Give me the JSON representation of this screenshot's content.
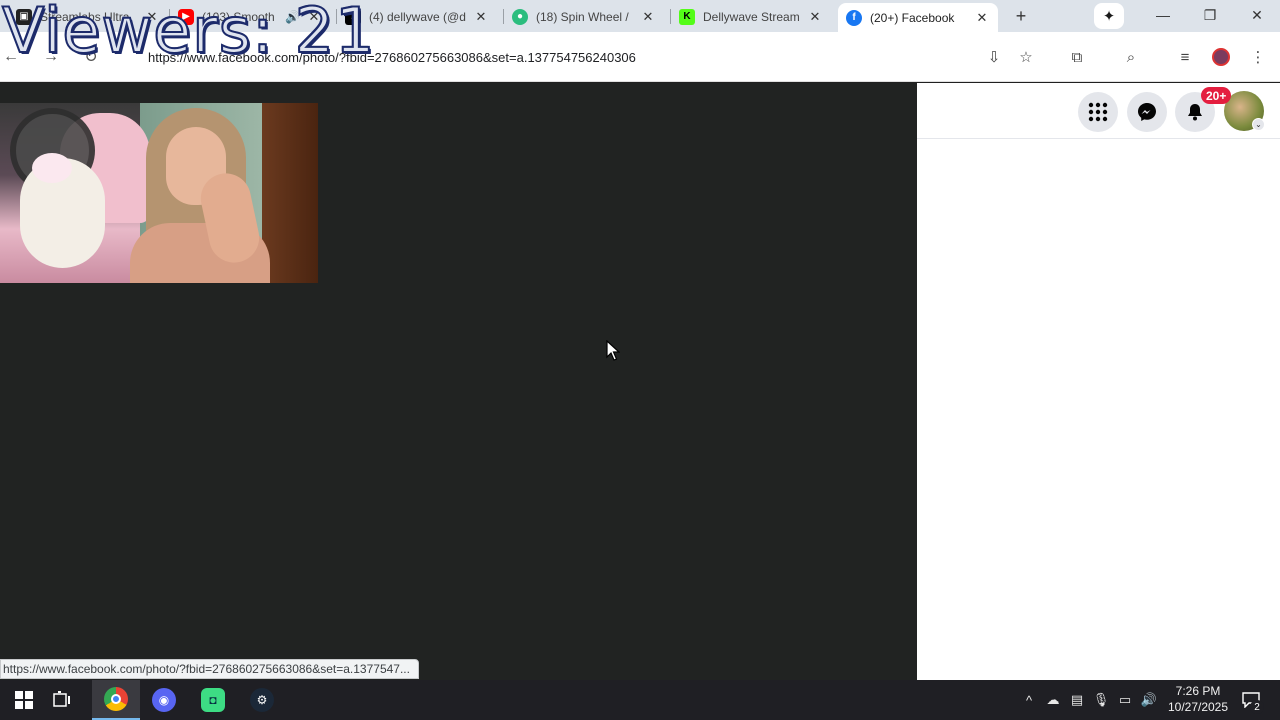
{
  "overlay": {
    "viewers_text": "Viewers: 21"
  },
  "tabs": [
    {
      "title": "Streamlabs Ultra",
      "icon": "streamlabs-icon",
      "color": "#222222"
    },
    {
      "title": "(103) Smooth",
      "icon": "youtube-icon",
      "color": "#ff0000",
      "audio": "🔊"
    },
    {
      "title": "(4) dellywave (@d",
      "icon": "tiktok-icon",
      "color": "#000000"
    },
    {
      "title": "(18) Spin Wheel /",
      "icon": "spinwheel-icon",
      "color": "#2bbd7e"
    },
    {
      "title": "Dellywave Stream",
      "icon": "kick-icon",
      "color": "#53fc18"
    },
    {
      "title": "(20+) Facebook",
      "icon": "facebook-icon",
      "color": "#1877f2",
      "active": true
    }
  ],
  "window": {
    "minimize": "—",
    "restore": "❐",
    "close": "✕",
    "new_tab": "+",
    "gemini": "✦",
    "close_tab": "✕"
  },
  "toolbar": {
    "url": "https://www.facebook.com/photo/?fbid=276860275663086&set=a.137754756240306"
  },
  "facebook": {
    "notification_badge": "20+",
    "menu_icon": "grid-menu-icon",
    "messenger_icon": "messenger-icon",
    "notifications_icon": "bell-icon",
    "chevron": "⌄"
  },
  "status_bar": {
    "link": "https://www.facebook.com/photo/?fbid=276860275663086&set=a.1377547..."
  },
  "taskbar": {
    "apps": [
      "windows-start",
      "task-view",
      "chrome",
      "discord",
      "android-studio",
      "steam"
    ],
    "time": "7:26 PM",
    "date": "10/27/2025",
    "notification_count": "2",
    "chevron": "^"
  },
  "colors": {
    "photo_bg": "#212322",
    "facebook_blue": "#1877f2",
    "badge_red": "#e41e3f",
    "taskbar": "#1f1f24"
  }
}
